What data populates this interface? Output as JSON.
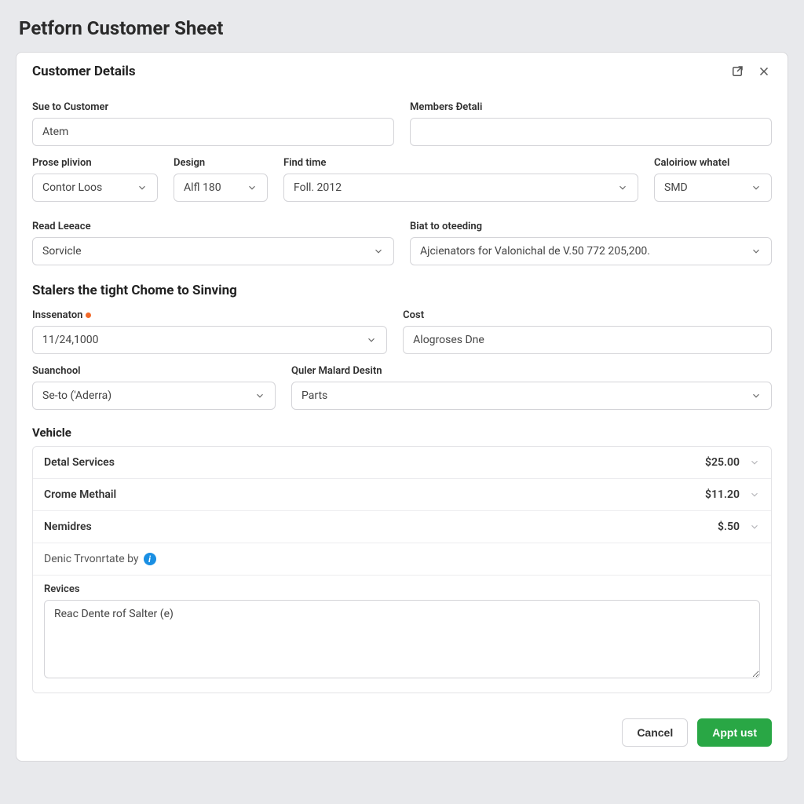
{
  "page": {
    "title": "Petforn Customer Sheet"
  },
  "sheet": {
    "header_title": "Customer Details",
    "footer": {
      "cancel": "Cancel",
      "submit": "Appt ust"
    }
  },
  "fields": {
    "suo_customer": {
      "label": "Sue to Customer",
      "value": "Atem"
    },
    "members": {
      "label": "Members Đetali",
      "value": ""
    },
    "prose_plivion": {
      "label": "Prose plivion",
      "value": "Contor Loos"
    },
    "design": {
      "label": "Design",
      "value": "Alfl 180"
    },
    "find_time": {
      "label": "Find time",
      "value": "Foll. 2012"
    },
    "caloiriow_whatel": {
      "label": "Caloiriow whatel",
      "value": "SMD"
    },
    "read_leeace": {
      "label": "Read Leeace",
      "value": "Sorvicle"
    },
    "biat_to": {
      "label": "Biat to oteeding",
      "value": "Ajcienators for Valonichal de V.50 772 205,200."
    },
    "section2_heading": "Stalers the tight Chome to Sinving",
    "inssenaton": {
      "label": "Inssenaton",
      "value": "11/24,1000",
      "required": true
    },
    "cost": {
      "label": "Cost",
      "value": "Alogroses Dne"
    },
    "suanchool": {
      "label": "Suanchool",
      "value": "Se-to ('Aderra)"
    },
    "quler": {
      "label": "Quler Malard Desitn",
      "value": "Parts"
    }
  },
  "vehicle": {
    "heading": "Vehicle",
    "items": [
      {
        "name": "Detal Services",
        "price": "$25.00"
      },
      {
        "name": "Crome Methail",
        "price": "$11.20"
      },
      {
        "name": "Nemidres",
        "price": "$.50"
      }
    ],
    "note": "Denic Trvonrtate by",
    "revices_label": "Revices",
    "revices_value": "Reac Dente rof Salter (e)"
  }
}
